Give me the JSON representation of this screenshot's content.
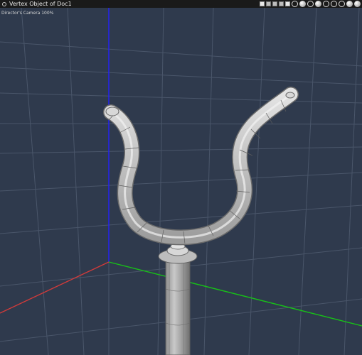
{
  "window": {
    "title": "Vertex Object of Doc1"
  },
  "toolbar": {
    "icons": [
      "layout-single-icon",
      "layout-split-icon",
      "layout-quad-icon",
      "layout-grid-icon",
      "grid-toggle-icon",
      "camera-rotate-icon",
      "camera-pan-icon",
      "camera-dolly-icon",
      "camera-zoom-icon",
      "display-mode-icon",
      "wireframe-cube-icon",
      "solid-cube-icon",
      "render-sphere-icon",
      "light-sphere-icon"
    ]
  },
  "viewport": {
    "camera_label": "Director's Camera 100%",
    "background_color": "#2f3a4d",
    "grid_color": "#4a566a",
    "axis_x_color": "#d23a3a",
    "axis_y_color": "#2222ff",
    "axis_z_color": "#17c217",
    "object": "vertex-object-y-shaped-pole"
  }
}
